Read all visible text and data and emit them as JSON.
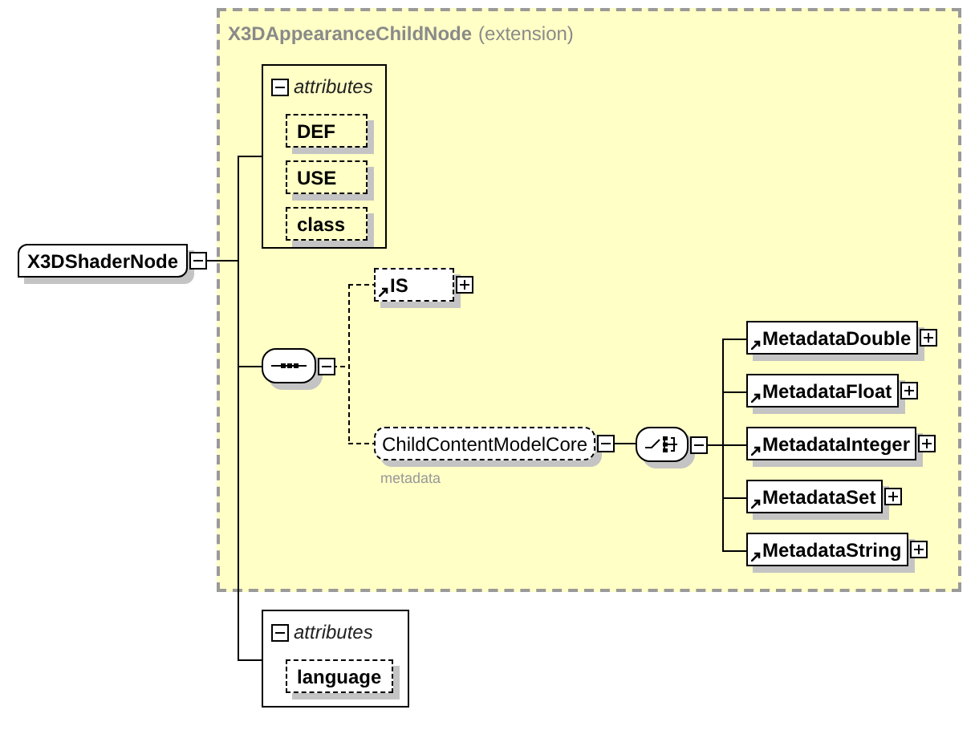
{
  "extension": {
    "title": "X3DAppearanceChildNode",
    "kind_label": "(extension)"
  },
  "element": {
    "name": "X3DShaderNode",
    "expanded": true
  },
  "attribute_groups": [
    {
      "label": "attributes",
      "expanded": true,
      "attributes": [
        {
          "name": "DEF",
          "optional": true
        },
        {
          "name": "USE",
          "optional": true
        },
        {
          "name": "class",
          "optional": true
        }
      ]
    },
    {
      "label": "attributes",
      "expanded": true,
      "attributes": [
        {
          "name": "language",
          "optional": true
        }
      ]
    }
  ],
  "sequence": {
    "expanded": true,
    "items": [
      {
        "kind": "element",
        "name": "IS",
        "optional": true,
        "reference": true,
        "expanded": false
      },
      {
        "kind": "group",
        "name": "ChildContentModelCore",
        "optional": true,
        "expanded": true,
        "annotation": "metadata"
      }
    ]
  },
  "choice": {
    "expanded": true,
    "items": [
      {
        "name": "MetadataDouble",
        "optional": false,
        "reference": true,
        "expanded": false
      },
      {
        "name": "MetadataFloat",
        "optional": false,
        "reference": true,
        "expanded": false
      },
      {
        "name": "MetadataInteger",
        "optional": false,
        "reference": true,
        "expanded": false
      },
      {
        "name": "MetadataSet",
        "optional": false,
        "reference": true,
        "expanded": false
      },
      {
        "name": "MetadataString",
        "optional": false,
        "reference": true,
        "expanded": false
      }
    ]
  }
}
